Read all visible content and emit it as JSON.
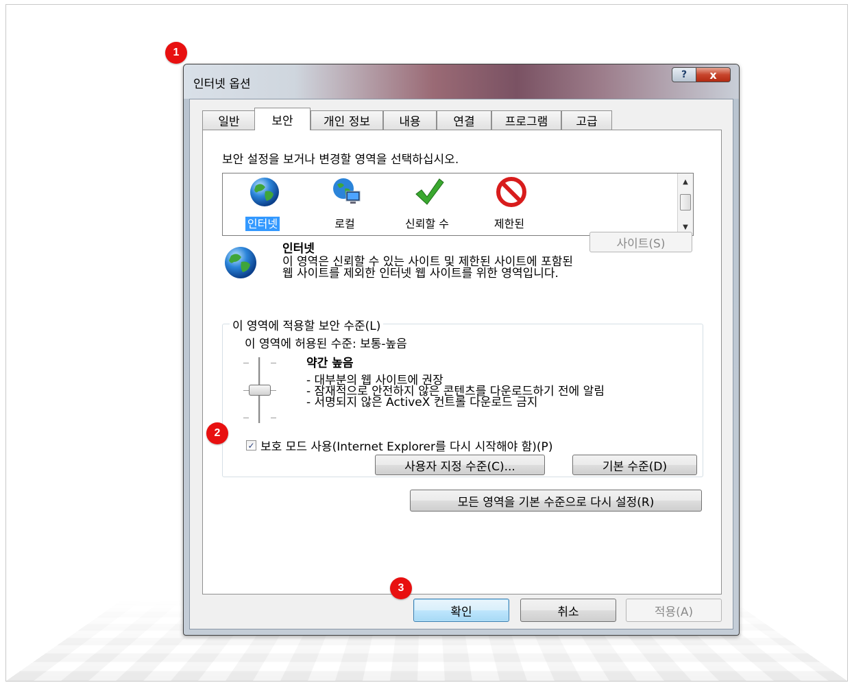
{
  "window": {
    "title": "인터넷 옵션",
    "help_label": "?",
    "close_label": "x"
  },
  "tabs": [
    {
      "label": "일반"
    },
    {
      "label": "보안",
      "active": true
    },
    {
      "label": "개인 정보"
    },
    {
      "label": "내용"
    },
    {
      "label": "연결"
    },
    {
      "label": "프로그램"
    },
    {
      "label": "고급"
    }
  ],
  "security": {
    "instruction": "보안 설정을 보거나 변경할 영역을 선택하십시오.",
    "zones": [
      {
        "label": "인터넷",
        "icon": "globe-icon",
        "selected": true
      },
      {
        "label": "로컬",
        "icon": "local-intranet-icon"
      },
      {
        "label": "신뢰할 수",
        "icon": "check-mark-icon"
      },
      {
        "label": "제한된",
        "icon": "restricted-icon"
      }
    ],
    "selected_zone_name": "인터넷",
    "zone_description": "이 영역은 신뢰할 수 있는 사이트 및 제한된 사이트에 포함된 웹 사이트를 제외한 인터넷 웹 사이트를 위한 영역입니다.",
    "sites_button": "사이트(S)",
    "level_group_title": "이 영역에 적용할 보안 수준(L)",
    "allowed_level": "이 영역에 허용된 수준: 보통-높음",
    "level_name": "약간 높음",
    "level_bullets": [
      "- 대부분의 웹 사이트에 권장",
      "- 잠재적으로 안전하지 않은 콘텐츠를 다운로드하기 전에 알림",
      "- 서명되지 않은 ActiveX 컨트롤 다운로드 금지"
    ],
    "slider_level": 0.6,
    "protected_mode_label": "보호 모드 사용(Internet Explorer를 다시 시작해야 함)(P)",
    "protected_mode_checked": true,
    "custom_level_button": "사용자 지정 수준(C)...",
    "default_level_button": "기본 수준(D)",
    "reset_all_button": "모든 영역을 기본 수준으로 다시 설정(R)"
  },
  "footer": {
    "ok_button": "확인",
    "cancel_button": "취소",
    "apply_button": "적용(A)"
  },
  "badges": [
    "1",
    "2",
    "3"
  ],
  "colors": {
    "badge": "#e81010",
    "selection": "#3399ff",
    "close_button": "#c7452c"
  }
}
